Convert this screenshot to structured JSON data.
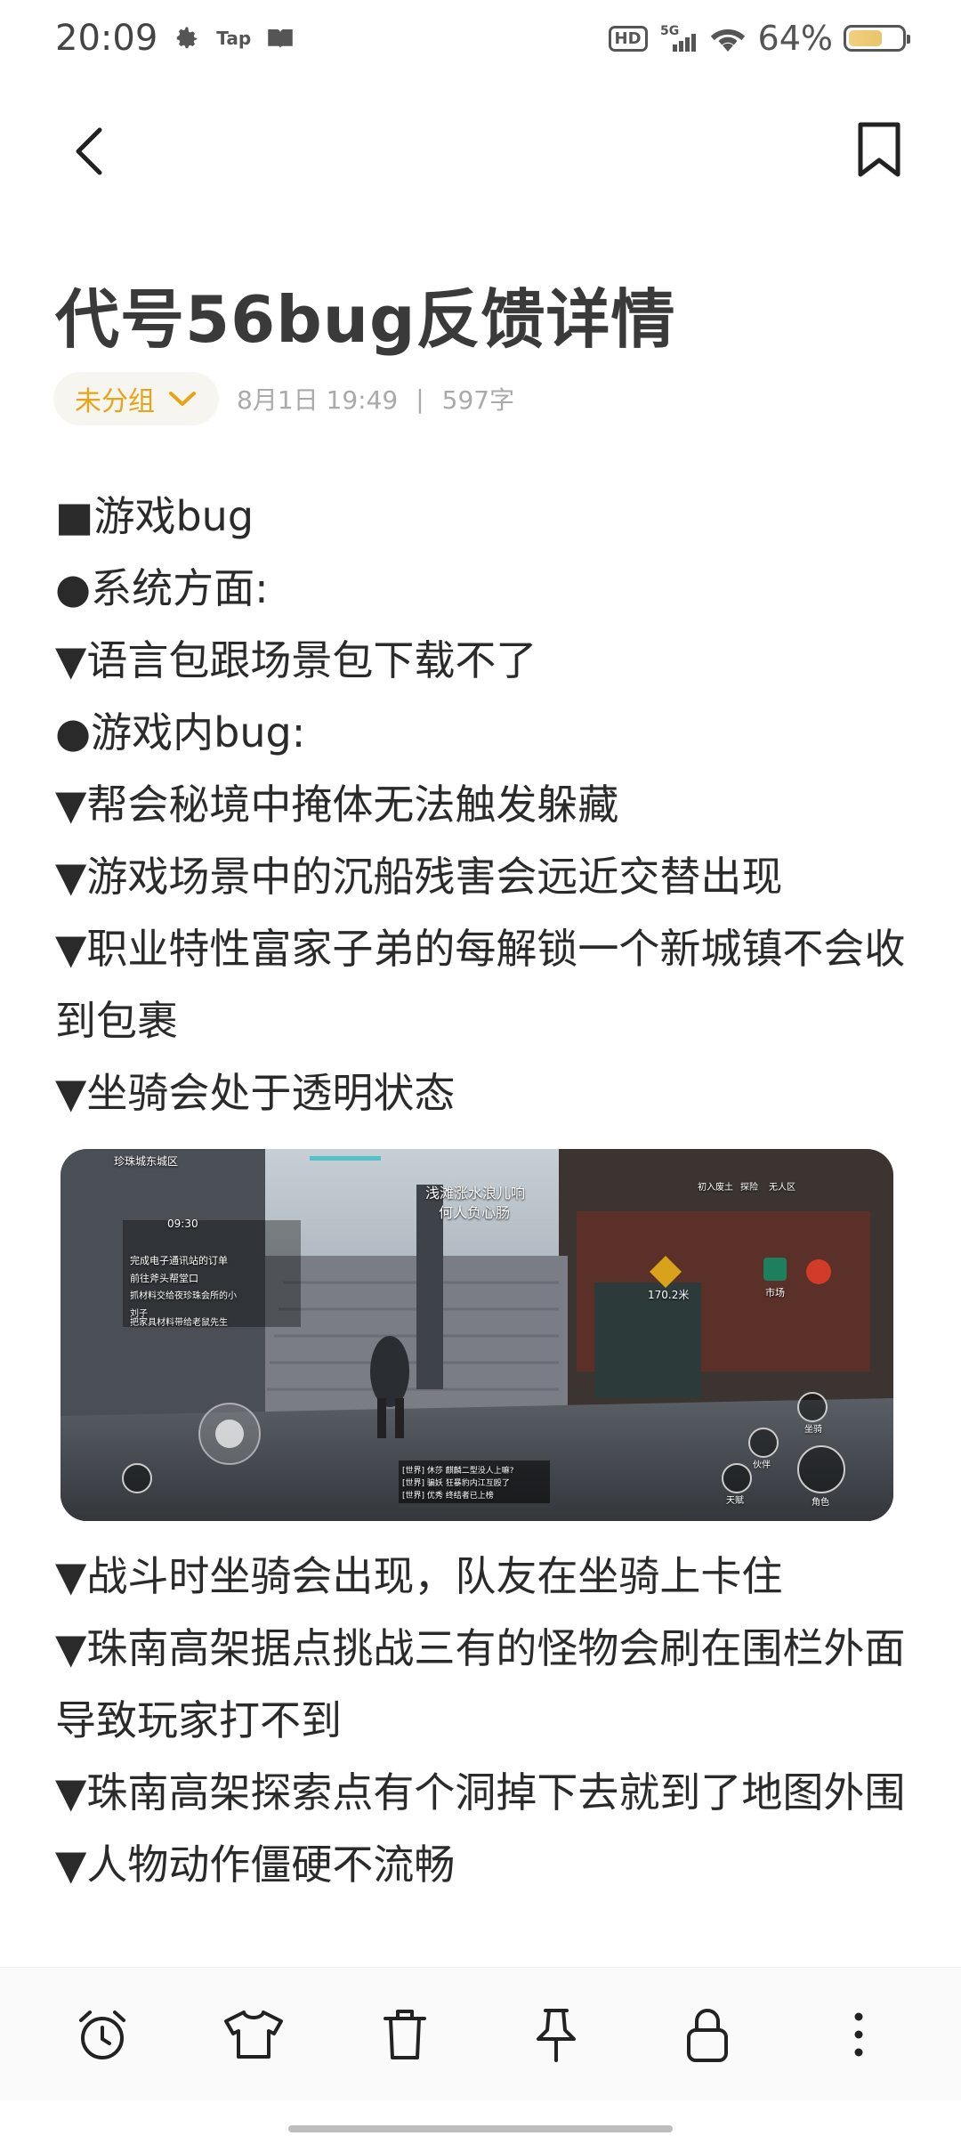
{
  "status_bar": {
    "time": "20:09",
    "tap_label": "Tap",
    "hd_label": "HD",
    "network_label": "5G",
    "battery_percent": "64%",
    "battery_level": 0.64,
    "icons": [
      "gear-icon",
      "book-icon",
      "wifi-icon",
      "signal-icon",
      "battery-icon"
    ]
  },
  "header": {
    "back_icon": "chevron-left-icon",
    "bookmark_icon": "bookmark-icon"
  },
  "note": {
    "title": "代号56bug反馈详情",
    "group_label": "未分组",
    "date": "8月1日 19:49",
    "separator": "|",
    "word_count": "597字",
    "lines": [
      "■游戏bug",
      "●系统方面:",
      "▼语言包跟场景包下载不了",
      "●游戏内bug:",
      "▼帮会秘境中掩体无法触发躲藏",
      "▼游戏场景中的沉船残害会远近交替出现",
      "▼职业特性富家子弟的每解锁一个新城镇不会收到包裹",
      "▼坐骑会处于透明状态"
    ],
    "lines_after": [
      "▼战斗时坐骑会出现，队友在坐骑上卡住",
      "▼珠南高架据点挑战三有的怪物会刷在围栏外面导致玩家打不到",
      "▼珠南高架探索点有个洞掉下去就到了地图外围",
      "▼人物动作僵硬不流畅"
    ]
  },
  "screenshot": {
    "zone_label": "珍珠城东城区",
    "time_label": "09:30",
    "center_text_1": "浅滩涨水浪儿响",
    "center_text_2": "何人负心肠",
    "distance_label": "170.2米",
    "market_label": "市场",
    "top_icons": [
      "初入废土",
      "探险",
      "无人区"
    ],
    "quests": [
      "完成电子通讯站的订单",
      "前往斧头帮堂口",
      "抓材料交给夜珍珠会所的小刘子",
      "把家具材料带给老鼠先生"
    ],
    "chat_lines": [
      "[世界] 休莎 麒麟二型没人上嘛?",
      "[世界] 骗妖 狂暴豹内江互殴了",
      "[世界] 优秀 终结者已上榜"
    ],
    "right_labels": [
      "伙伴",
      "坐骑",
      "天赋",
      "角色"
    ]
  },
  "toolbar": {
    "icons": [
      "alarm-clock-icon",
      "shirt-icon",
      "trash-icon",
      "pin-icon",
      "lock-icon",
      "more-icon"
    ]
  }
}
